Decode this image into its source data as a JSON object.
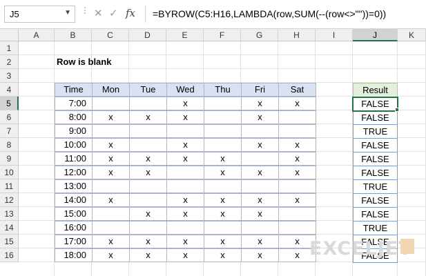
{
  "formula_bar": {
    "name_box": "J5",
    "fx_symbol": "fx",
    "formula": "=BYROW(C5:H16,LAMBDA(row,SUM(--(row<>\"\"))=0))"
  },
  "columns": [
    "A",
    "B",
    "C",
    "D",
    "E",
    "F",
    "G",
    "H",
    "I",
    "J",
    "K"
  ],
  "rows": [
    "1",
    "2",
    "3",
    "4",
    "5",
    "6",
    "7",
    "8",
    "9",
    "10",
    "11",
    "12",
    "13",
    "14",
    "15",
    "16"
  ],
  "active_cell": {
    "column": "J",
    "row": "5"
  },
  "sheet": {
    "title": "Row is blank",
    "table_headers": [
      "Time",
      "Mon",
      "Tue",
      "Wed",
      "Thu",
      "Fri",
      "Sat"
    ],
    "table_rows": [
      [
        "7:00",
        "",
        "",
        "x",
        "",
        "x",
        "x"
      ],
      [
        "8:00",
        "x",
        "x",
        "x",
        "",
        "x",
        ""
      ],
      [
        "9:00",
        "",
        "",
        "",
        "",
        "",
        ""
      ],
      [
        "10:00",
        "x",
        "",
        "x",
        "",
        "x",
        "x"
      ],
      [
        "11:00",
        "x",
        "x",
        "x",
        "x",
        "",
        "x"
      ],
      [
        "12:00",
        "x",
        "x",
        "",
        "x",
        "x",
        "x"
      ],
      [
        "13:00",
        "",
        "",
        "",
        "",
        "",
        ""
      ],
      [
        "14:00",
        "x",
        "",
        "x",
        "x",
        "x",
        "x"
      ],
      [
        "15:00",
        "",
        "x",
        "x",
        "x",
        "x",
        ""
      ],
      [
        "16:00",
        "",
        "",
        "",
        "",
        "",
        ""
      ],
      [
        "17:00",
        "x",
        "x",
        "x",
        "x",
        "x",
        "x"
      ],
      [
        "18:00",
        "x",
        "x",
        "x",
        "x",
        "x",
        "x"
      ]
    ],
    "result_header": "Result",
    "results": [
      "FALSE",
      "FALSE",
      "TRUE",
      "FALSE",
      "FALSE",
      "FALSE",
      "TRUE",
      "FALSE",
      "FALSE",
      "TRUE",
      "FALSE",
      "FALSE"
    ]
  },
  "watermark": "EXCELJET",
  "colors": {
    "table_header_fill": "#d9e1f2",
    "result_header_fill": "#e2efda",
    "selection_border": "#217346"
  }
}
